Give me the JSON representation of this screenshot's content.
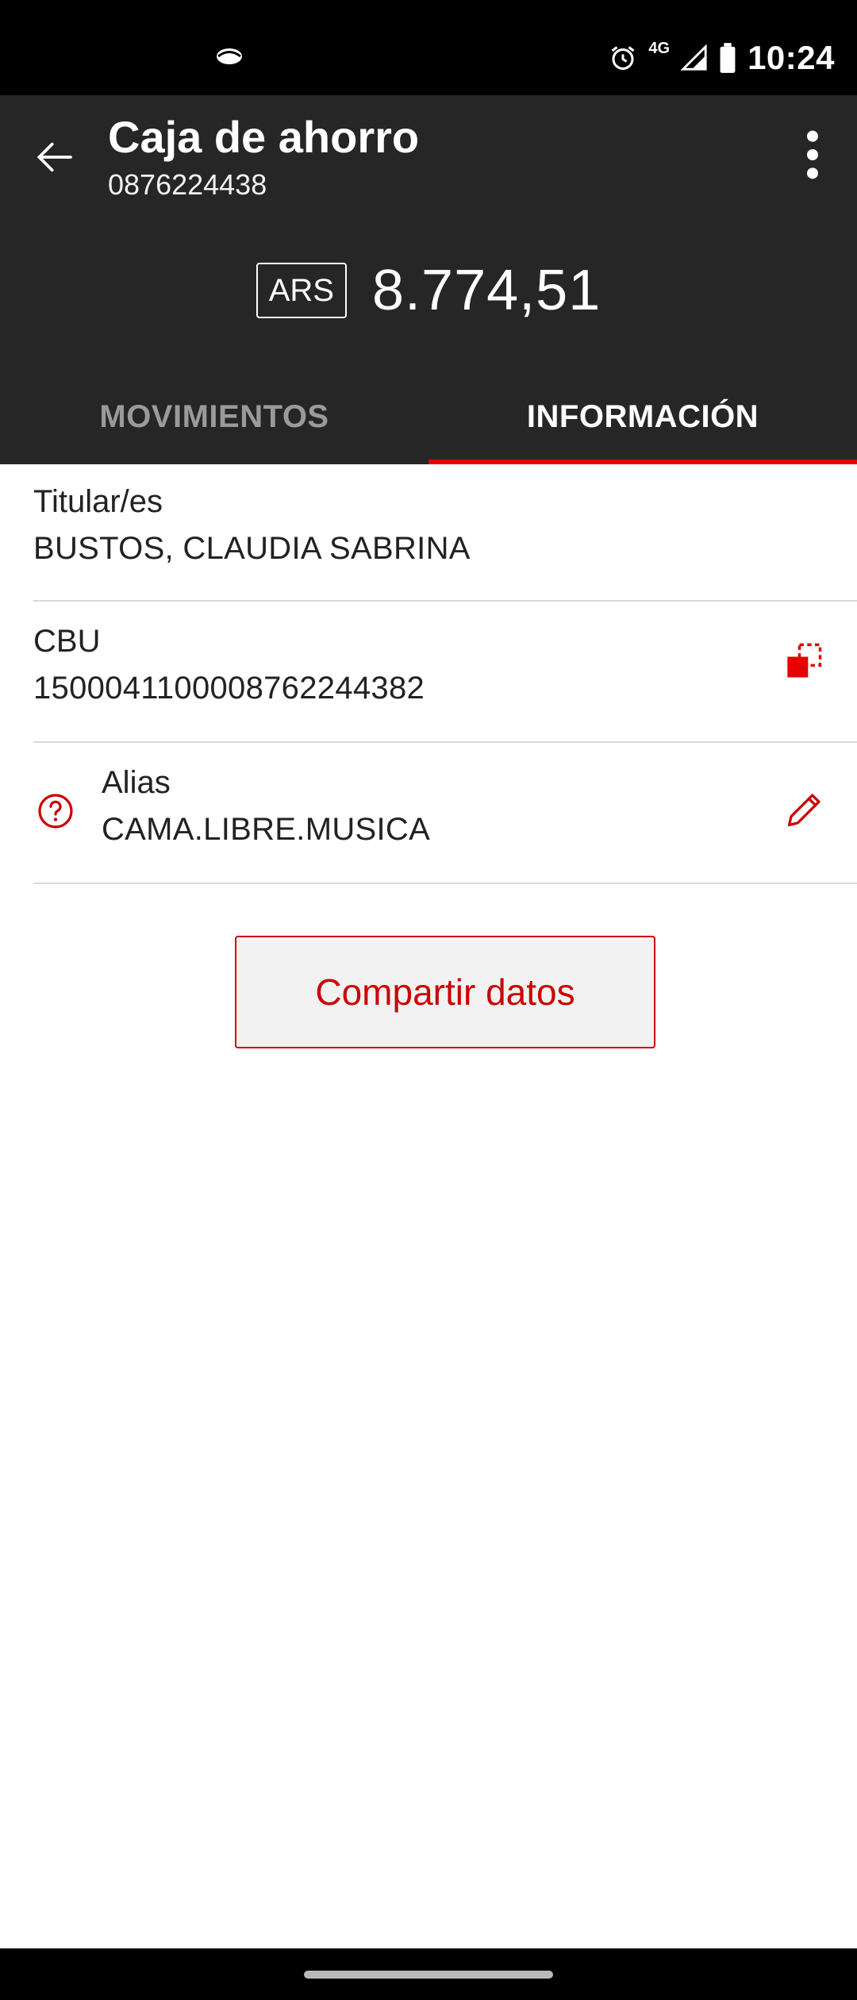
{
  "status_bar": {
    "time": "10:24",
    "network": "4G",
    "icons": [
      "notification-icon",
      "alarm-icon",
      "signal-icon",
      "battery-icon"
    ]
  },
  "header": {
    "title": "Caja de ahorro",
    "account_number": "0876224438",
    "currency": "ARS",
    "balance": "8.774,51"
  },
  "tabs": [
    {
      "label": "MOVIMIENTOS",
      "active": false
    },
    {
      "label": "INFORMACIÓN",
      "active": true
    }
  ],
  "info": {
    "holders_label": "Titular/es",
    "holders_value": "BUSTOS, CLAUDIA SABRINA",
    "cbu_label": "CBU",
    "cbu_value": "1500041100008762244382",
    "alias_label": "Alias",
    "alias_value": "CAMA.LIBRE.MUSICA"
  },
  "actions": {
    "share_label": "Compartir datos"
  },
  "colors": {
    "header_bg": "#262626",
    "accent": "#e60000",
    "button_bg": "#f2f2f2",
    "divider": "#d9d9d9"
  }
}
